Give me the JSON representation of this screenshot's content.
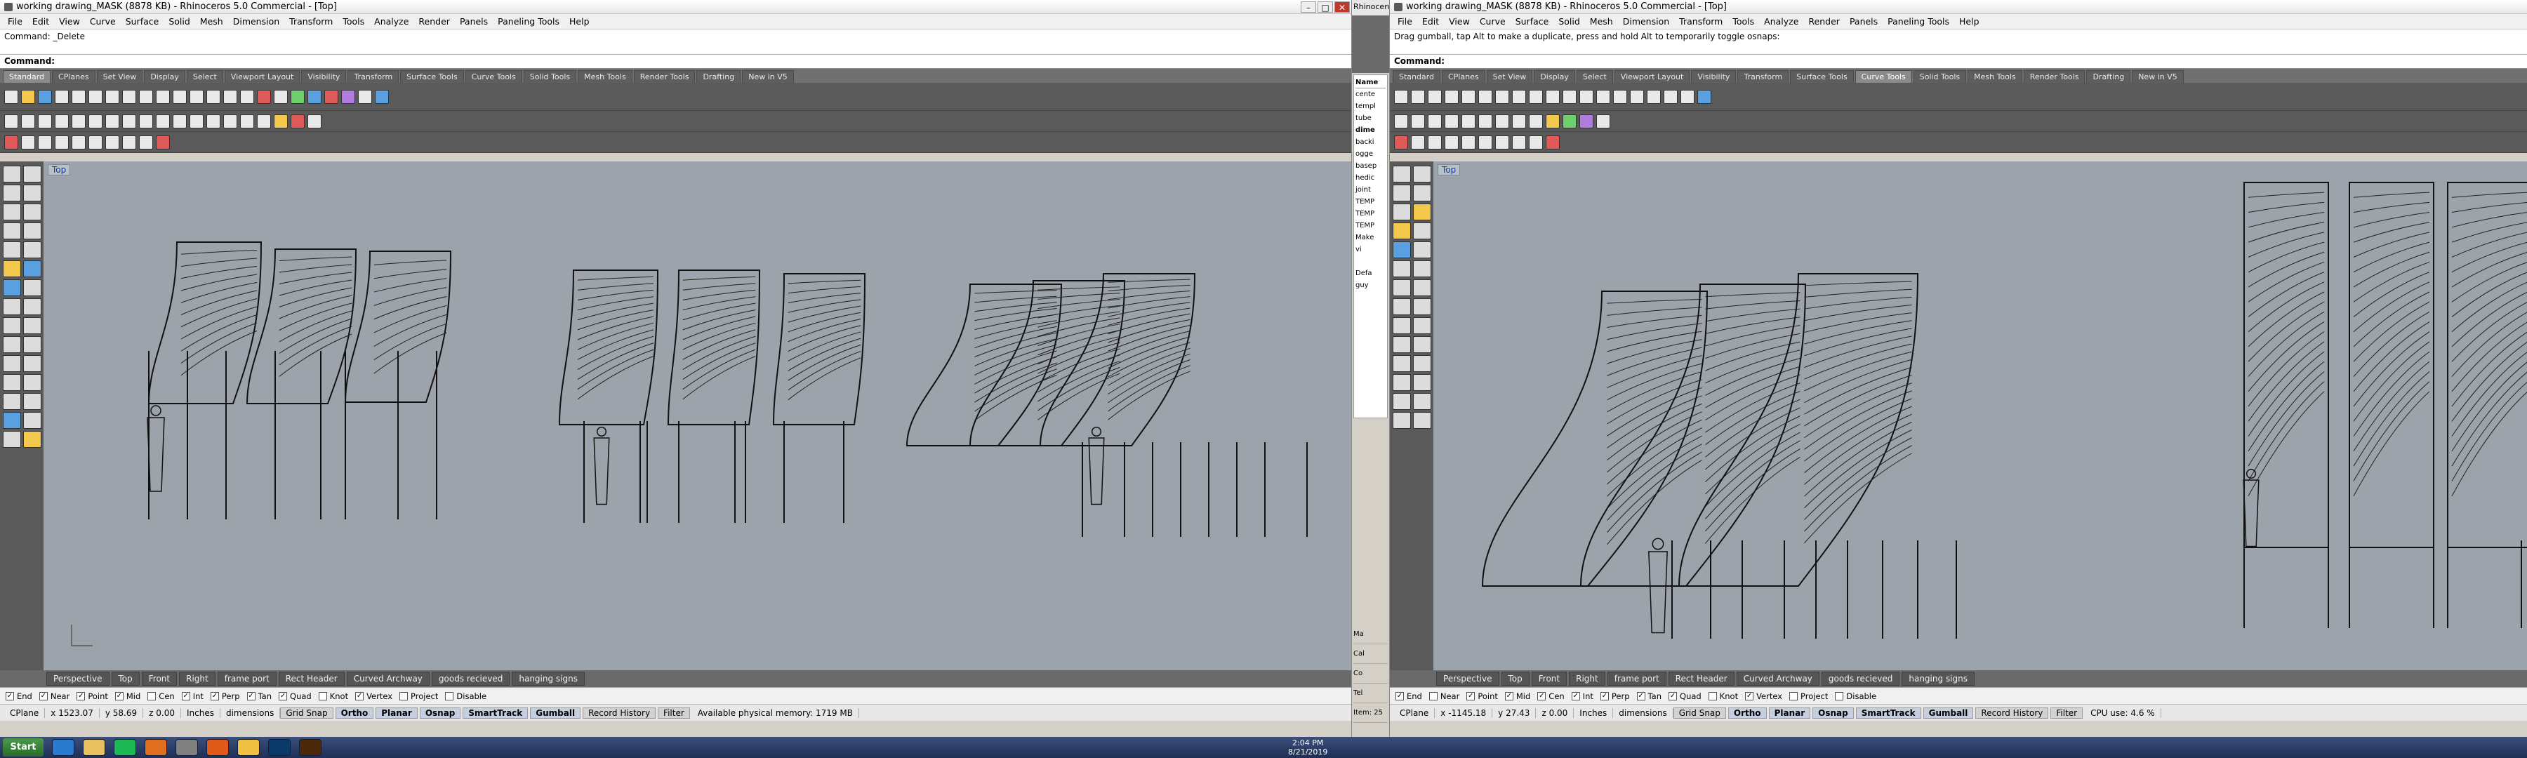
{
  "left_window": {
    "title": "working drawing_MASK (8878 KB) - Rhinoceros 5.0 Commercial - [Top]",
    "menu": [
      "File",
      "Edit",
      "View",
      "Curve",
      "Surface",
      "Solid",
      "Mesh",
      "Dimension",
      "Transform",
      "Tools",
      "Analyze",
      "Render",
      "Panels",
      "Paneling Tools",
      "Help"
    ],
    "command_history": [
      "Command: _Delete"
    ],
    "command_prompt": "Command:",
    "toolbar_tabs": [
      "Standard",
      "CPlanes",
      "Set View",
      "Display",
      "Select",
      "Viewport Layout",
      "Visibility",
      "Transform",
      "Surface Tools",
      "Curve Tools",
      "Solid Tools",
      "Mesh Tools",
      "Render Tools",
      "Drafting",
      "New in V5"
    ],
    "viewport_label": "Top",
    "viewport_tabs": [
      "Perspective",
      "Top",
      "Front",
      "Right",
      "frame port",
      "Rect Header",
      "Curved Archway",
      "goods recieved",
      "hanging signs"
    ],
    "osnaps": [
      {
        "label": "End",
        "on": true
      },
      {
        "label": "Near",
        "on": true
      },
      {
        "label": "Point",
        "on": true
      },
      {
        "label": "Mid",
        "on": true
      },
      {
        "label": "Cen",
        "on": false
      },
      {
        "label": "Int",
        "on": true
      },
      {
        "label": "Perp",
        "on": true
      },
      {
        "label": "Tan",
        "on": true
      },
      {
        "label": "Quad",
        "on": true
      },
      {
        "label": "Knot",
        "on": false
      },
      {
        "label": "Vertex",
        "on": true
      },
      {
        "label": "Project",
        "on": false
      },
      {
        "label": "Disable",
        "on": false
      }
    ],
    "status": {
      "cplane": "CPlane",
      "x": "x 1523.07",
      "y": "y 58.69",
      "z": "z 0.00",
      "units": "Inches",
      "layer": "dimensions"
    },
    "status_panes": [
      "Grid Snap",
      "Ortho",
      "Planar",
      "Osnap",
      "SmartTrack",
      "Gumball",
      "Record History",
      "Filter"
    ],
    "memory": "Available physical memory: 1719 MB"
  },
  "right_window": {
    "title": "working drawing_MASK (8878 KB) - Rhinoceros 5.0 Commercial - [Top]",
    "menu": [
      "File",
      "Edit",
      "View",
      "Curve",
      "Surface",
      "Solid",
      "Mesh",
      "Dimension",
      "Transform",
      "Tools",
      "Analyze",
      "Render",
      "Panels",
      "Paneling Tools",
      "Help"
    ],
    "command_history": [
      "Drag gumball, tap Alt to make a duplicate, press and hold Alt to temporarily toggle osnaps:"
    ],
    "command_prompt": "Command:",
    "toolbar_tabs": [
      "Standard",
      "CPlanes",
      "Set View",
      "Display",
      "Select",
      "Viewport Layout",
      "Visibility",
      "Transform",
      "Surface Tools",
      "Curve Tools",
      "Solid Tools",
      "Mesh Tools",
      "Render Tools",
      "Drafting",
      "New in V5"
    ],
    "viewport_label": "Top",
    "viewport_tabs": [
      "Perspective",
      "Top",
      "Front",
      "Right",
      "frame port",
      "Rect Header",
      "Curved Archway",
      "goods recieved",
      "hanging signs"
    ],
    "osnaps": [
      {
        "label": "End",
        "on": true
      },
      {
        "label": "Near",
        "on": false
      },
      {
        "label": "Point",
        "on": true
      },
      {
        "label": "Mid",
        "on": true
      },
      {
        "label": "Cen",
        "on": true
      },
      {
        "label": "Int",
        "on": true
      },
      {
        "label": "Perp",
        "on": true
      },
      {
        "label": "Tan",
        "on": true
      },
      {
        "label": "Quad",
        "on": true
      },
      {
        "label": "Knot",
        "on": false
      },
      {
        "label": "Vertex",
        "on": true
      },
      {
        "label": "Project",
        "on": false
      },
      {
        "label": "Disable",
        "on": false
      }
    ],
    "status": {
      "cplane": "CPlane",
      "x": "x -1145.18",
      "y": "y 27.43",
      "z": "z 0.00",
      "units": "Inches",
      "layer": "dimensions"
    },
    "status_panes": [
      "Grid Snap",
      "Ortho",
      "Planar",
      "Osnap",
      "SmartTrack",
      "Gumball",
      "Record History",
      "Filter"
    ],
    "memory": "CPU use: 4.6 %"
  },
  "middle_panel": {
    "title": "Rhinocero",
    "layers_header": "Name",
    "layers": [
      "cente",
      "templ",
      "tube",
      "dime",
      "backi",
      "ogge",
      "basep",
      "hedic",
      "joint",
      "TEMP",
      "TEMP",
      "TEMP",
      "Make",
      "vi",
      "",
      "Defa",
      "guy"
    ],
    "lower": [
      "Ma",
      "Cal",
      "Co",
      "Tel"
    ],
    "status": "Item: 25"
  },
  "taskbar": {
    "start": "Start",
    "clock_time": "2:04 PM",
    "clock_date": "8/21/2019"
  }
}
